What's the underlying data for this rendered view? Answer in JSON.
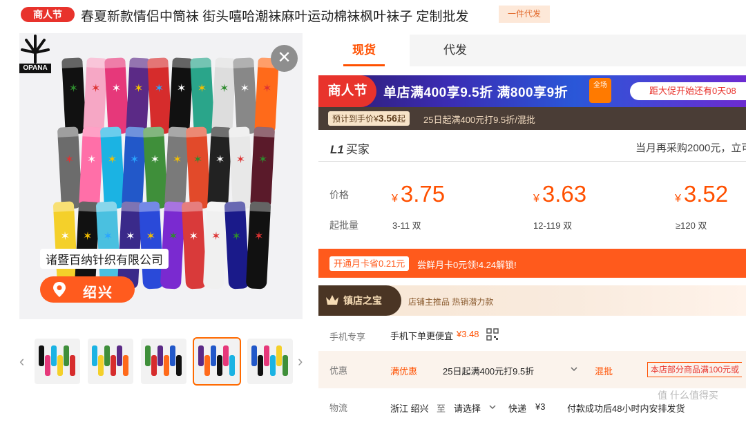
{
  "header": {
    "promo_badge": "商人节",
    "title": "春夏新款情侣中筒袜 街头嘻哈潮袜麻叶运动棉袜枫叶袜子 定制批发",
    "dropship_tag": "一件代发"
  },
  "gallery": {
    "brand": "OPANA",
    "supplier": "诸暨百纳针织有限公司",
    "location": "绍兴",
    "close_glyph": "✕",
    "prev_arrow": "‹",
    "next_arrow": "›"
  },
  "tabs": [
    {
      "label": "现货",
      "active": true
    },
    {
      "label": "代发",
      "active": false
    }
  ],
  "promo_banner": {
    "badge": "商人节",
    "offer": "单店满400享9.5折 满800享9折",
    "tag": "全场",
    "countdown": "距大促开始还有0天08"
  },
  "estimate": {
    "prefix": "预计到手价",
    "currency": "¥",
    "value": "3.56",
    "suffix": "起",
    "note": "25日起满400元打9.5折/混批"
  },
  "buyer": {
    "level": "L1",
    "level_text": "买家",
    "hint": "当月再采购2000元，立可"
  },
  "price_table": {
    "price_label": "价格",
    "moq_label": "起批量",
    "currency": "¥",
    "tiers": [
      {
        "price": "3.75",
        "moq": "3-11 双"
      },
      {
        "price": "3.63",
        "moq": "12-119 双"
      },
      {
        "price": "3.52",
        "moq": "≥120 双"
      }
    ]
  },
  "member": {
    "pill": "开通月卡省0.21元",
    "text": "尝鲜月卡0元领!4.24解锁!"
  },
  "treasure": {
    "title": "镇店之宝",
    "sub": "店铺主推品  热销潜力款"
  },
  "rows": {
    "phone_label": "手机专享",
    "phone_text": "手机下单更便宜",
    "phone_price": "¥3.48",
    "discount_label": "优惠",
    "discount_type": "满优惠",
    "discount_text": "25日起满400元打9.5折",
    "discount_mixed": "混批",
    "discount_note": "本店部分商品满100元或",
    "logistics_label": "物流",
    "logistics_from": "浙江 绍兴",
    "logistics_to_word": "至",
    "logistics_to": "请选择",
    "logistics_method": "快递",
    "logistics_fee": "¥3",
    "logistics_ship": "付款成功后48小时内安排发货"
  },
  "watermark": "值 什么值得买",
  "colors": {
    "accent": "#ff5000",
    "promo_red": "#e8332c"
  }
}
